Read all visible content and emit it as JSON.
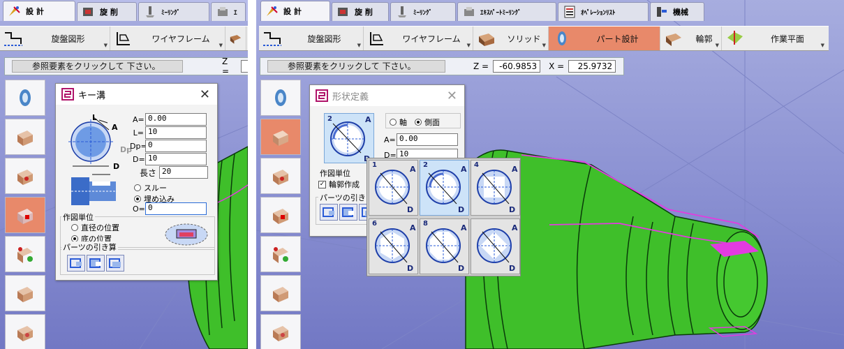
{
  "left": {
    "tabs": [
      {
        "label": "設 計",
        "icon": "design-icon",
        "active": true
      },
      {
        "label": "旋 削",
        "icon": "turning-icon"
      },
      {
        "label": "ﾐｰﾘﾝｸﾞ",
        "icon": "milling-icon"
      },
      {
        "label": "ｴ",
        "icon": "expert-milling-icon"
      }
    ],
    "toolbar": [
      {
        "label": "旋盤図形",
        "icon": "lathe-shape-icon"
      },
      {
        "label": "ワイヤフレーム",
        "icon": "wireframe-icon"
      }
    ],
    "status": {
      "message": "参照要素をクリックして 下さい。",
      "z_label": "Z ="
    },
    "dialog": {
      "title": "キー溝",
      "fields": [
        {
          "label": "A=",
          "value": "0.00"
        },
        {
          "label": "L=",
          "value": "10"
        },
        {
          "label": "Dp=",
          "value": "0"
        },
        {
          "label": "D=",
          "value": "10"
        }
      ],
      "length_label": "長さ",
      "length_value": "20",
      "radio_through": "スルー",
      "radio_embed": "埋め込み",
      "o_label": "O=",
      "o_value": "0",
      "unit_group": "作図単位",
      "unit_diameter": "直径の位置",
      "unit_bottom": "底の位置",
      "subtract_group": "パーツの引き算",
      "diagram_labels": {
        "l": "L",
        "a": "A",
        "dp": "Dp",
        "d": "D"
      }
    }
  },
  "right": {
    "tabs": [
      {
        "label": "設 計",
        "icon": "design-icon",
        "active": true
      },
      {
        "label": "旋 削",
        "icon": "turning-icon"
      },
      {
        "label": "ﾐｰﾘﾝｸﾞ",
        "icon": "milling-icon"
      },
      {
        "label": "ｴｷｽﾊﾟｰﾄﾐｰﾘﾝｸﾞ",
        "icon": "expert-milling-icon"
      },
      {
        "label": "ｵﾍﾟﾚｰｼｮﾝﾘｽﾄ",
        "icon": "operation-list-icon"
      },
      {
        "label": "機械",
        "icon": "machine-icon"
      }
    ],
    "toolbar": [
      {
        "label": "旋盤図形",
        "icon": "lathe-shape-icon"
      },
      {
        "label": "ワイヤフレーム",
        "icon": "wireframe-icon"
      },
      {
        "label": "ソリッド",
        "icon": "solid-icon"
      },
      {
        "label": "パート設計",
        "icon": "part-design-icon",
        "highlight": true
      },
      {
        "label": "輪郭",
        "icon": "contour-icon"
      },
      {
        "label": "作業平面",
        "icon": "work-plane-icon"
      }
    ],
    "status": {
      "message": "参照要素をクリックして 下さい。",
      "z_label": "Z =",
      "z_value": "-60.9853",
      "x_label": "X =",
      "x_value": "25.9732"
    },
    "dialog": {
      "title": "形状定義",
      "radio_axis": "軸",
      "radio_side": "側面",
      "fields": [
        {
          "label": "A=",
          "value": "0.00"
        },
        {
          "label": "D=",
          "value": "10"
        }
      ],
      "unit_group": "作図単位",
      "contour_check": "輪郭作成",
      "subtract_group": "パーツの引き"
    },
    "shape_options": [
      "1",
      "2",
      "4",
      "6",
      "8",
      ""
    ],
    "diagram_labels": {
      "a": "A",
      "d": "D",
      "n": "2"
    }
  },
  "colors": {
    "highlight": "#e8896a",
    "part_green": "#3fbf2a",
    "magenta": "#e23be0",
    "viewport": "#8a90d2"
  }
}
